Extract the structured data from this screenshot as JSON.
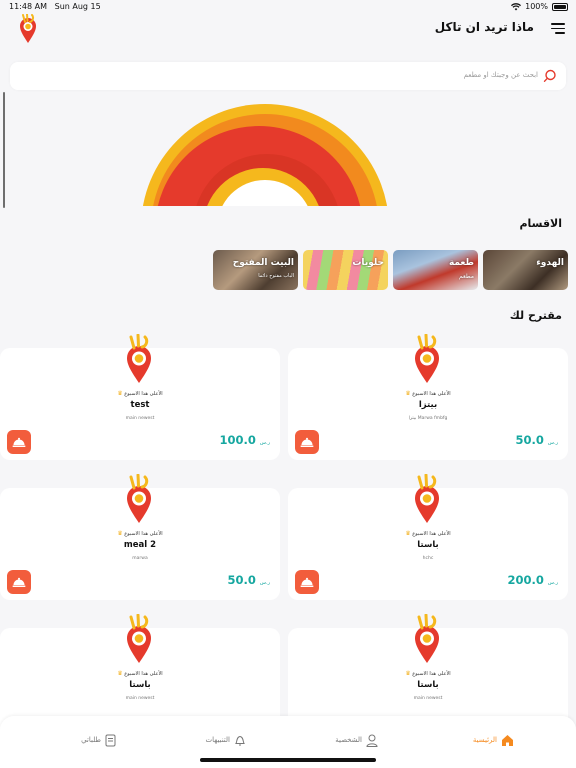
{
  "status_bar": {
    "time": "11:48 AM",
    "date": "Sun Aug 15",
    "battery": "100%"
  },
  "header": {
    "title": "ماذا تريد ان تاكل"
  },
  "search": {
    "placeholder": "ابحث عن وجبتك او مطعم"
  },
  "categories": {
    "title": "الاقسام",
    "items": [
      {
        "label": "الهدوء",
        "sub": ""
      },
      {
        "label": "طعمة",
        "sub": "مطعم"
      },
      {
        "label": "حلويات",
        "sub": ""
      },
      {
        "label": "البيت المفتوح",
        "sub": "الباب مفتوح دائما"
      }
    ]
  },
  "suggested": {
    "title": "مقترح لك",
    "products": [
      {
        "badge": "الأعلى هذا الاسبوع",
        "name": "بيتزا",
        "desc": "بيتزا Marwa fmbfg",
        "price": "50.0",
        "currency": "ر.س"
      },
      {
        "badge": "الأعلى هذا الاسبوع",
        "name": "test",
        "desc": "main newest",
        "price": "100.0",
        "currency": "ر.س"
      },
      {
        "badge": "الأعلى هذا الاسبوع",
        "name": "باستا",
        "desc": "hchc",
        "price": "200.0",
        "currency": "ر.س"
      },
      {
        "badge": "الأعلى هذا الاسبوع",
        "name": "meal 2",
        "desc": "marwa",
        "price": "50.0",
        "currency": "ر.س"
      },
      {
        "badge": "الأعلى هذا الاسبوع",
        "name": "باستا",
        "desc": "main newest",
        "price": "",
        "currency": ""
      },
      {
        "badge": "الأعلى هذا الاسبوع",
        "name": "باستا",
        "desc": "main newest",
        "price": "",
        "currency": ""
      }
    ]
  },
  "bottom_nav": {
    "items": [
      {
        "label": "الرئيسية",
        "icon": "home-icon",
        "active": true
      },
      {
        "label": "الشخصية",
        "icon": "person-icon",
        "active": false
      },
      {
        "label": "التنبيهات",
        "icon": "bell-icon",
        "active": false
      },
      {
        "label": "طلباتي",
        "icon": "orders-icon",
        "active": false
      }
    ]
  },
  "colors": {
    "accent": "#f58a1f",
    "price": "#16a7a0",
    "add_button": "#f25d3c",
    "logo_red": "#e53a2c",
    "logo_yellow": "#f5b81d"
  }
}
